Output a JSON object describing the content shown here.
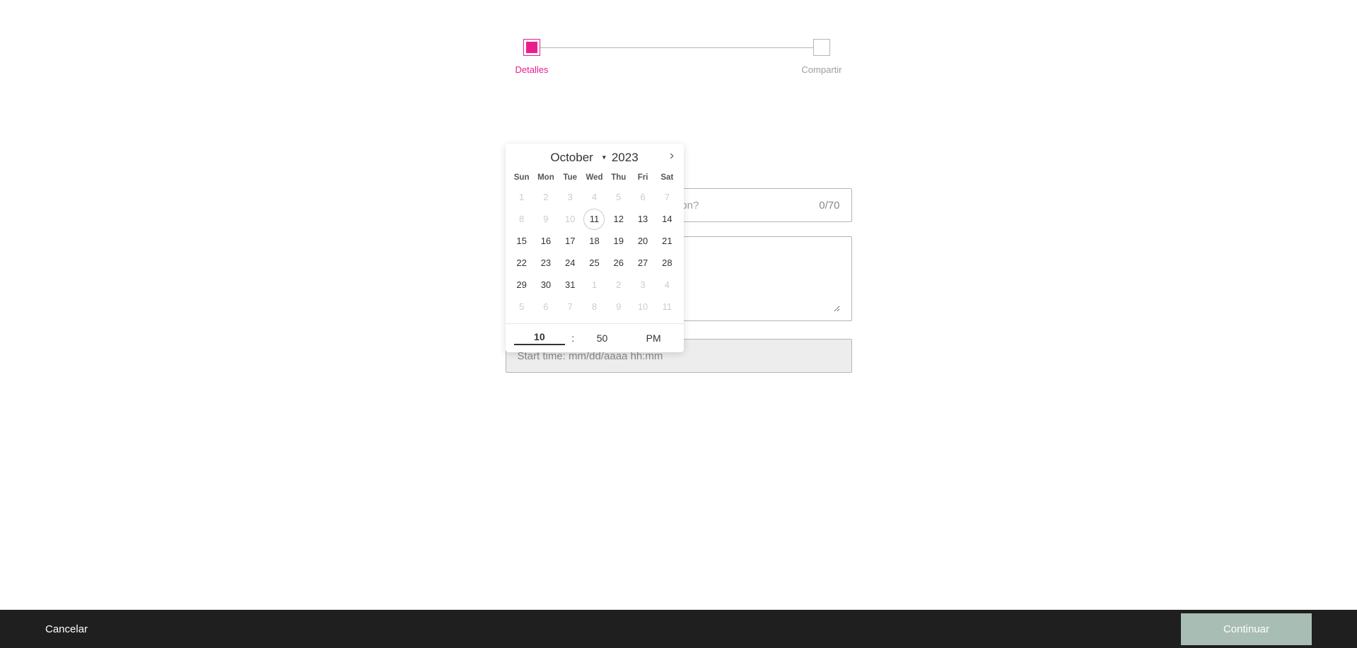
{
  "stepper": {
    "step1": {
      "label": "Detalles",
      "active": true
    },
    "step2": {
      "label": "Compartir",
      "active": false
    }
  },
  "question": {
    "placeholder_tail": "on?",
    "counter": "0/70"
  },
  "description": {
    "placeholder": ""
  },
  "start_time": {
    "label": "Start time: mm/dd/aaaa hh:mm"
  },
  "calendar": {
    "month": "October",
    "year": "2023",
    "weekdays": [
      "Sun",
      "Mon",
      "Tue",
      "Wed",
      "Thu",
      "Fri",
      "Sat"
    ],
    "days": [
      {
        "n": "1",
        "muted": true
      },
      {
        "n": "2",
        "muted": true
      },
      {
        "n": "3",
        "muted": true
      },
      {
        "n": "4",
        "muted": true
      },
      {
        "n": "5",
        "muted": true
      },
      {
        "n": "6",
        "muted": true
      },
      {
        "n": "7",
        "muted": true
      },
      {
        "n": "8",
        "muted": true
      },
      {
        "n": "9",
        "muted": true
      },
      {
        "n": "10",
        "muted": true
      },
      {
        "n": "11",
        "today": true
      },
      {
        "n": "12"
      },
      {
        "n": "13"
      },
      {
        "n": "14"
      },
      {
        "n": "15"
      },
      {
        "n": "16"
      },
      {
        "n": "17"
      },
      {
        "n": "18"
      },
      {
        "n": "19"
      },
      {
        "n": "20"
      },
      {
        "n": "21"
      },
      {
        "n": "22"
      },
      {
        "n": "23"
      },
      {
        "n": "24"
      },
      {
        "n": "25"
      },
      {
        "n": "26"
      },
      {
        "n": "27"
      },
      {
        "n": "28"
      },
      {
        "n": "29"
      },
      {
        "n": "30"
      },
      {
        "n": "31"
      },
      {
        "n": "1",
        "muted": true
      },
      {
        "n": "2",
        "muted": true
      },
      {
        "n": "3",
        "muted": true
      },
      {
        "n": "4",
        "muted": true
      },
      {
        "n": "5",
        "muted": true
      },
      {
        "n": "6",
        "muted": true
      },
      {
        "n": "7",
        "muted": true
      },
      {
        "n": "8",
        "muted": true
      },
      {
        "n": "9",
        "muted": true
      },
      {
        "n": "10",
        "muted": true
      },
      {
        "n": "11",
        "muted": true
      }
    ],
    "time": {
      "hour": "10",
      "minute": "50",
      "ampm": "PM"
    }
  },
  "footer": {
    "cancel": "Cancelar",
    "continue": "Continuar"
  }
}
